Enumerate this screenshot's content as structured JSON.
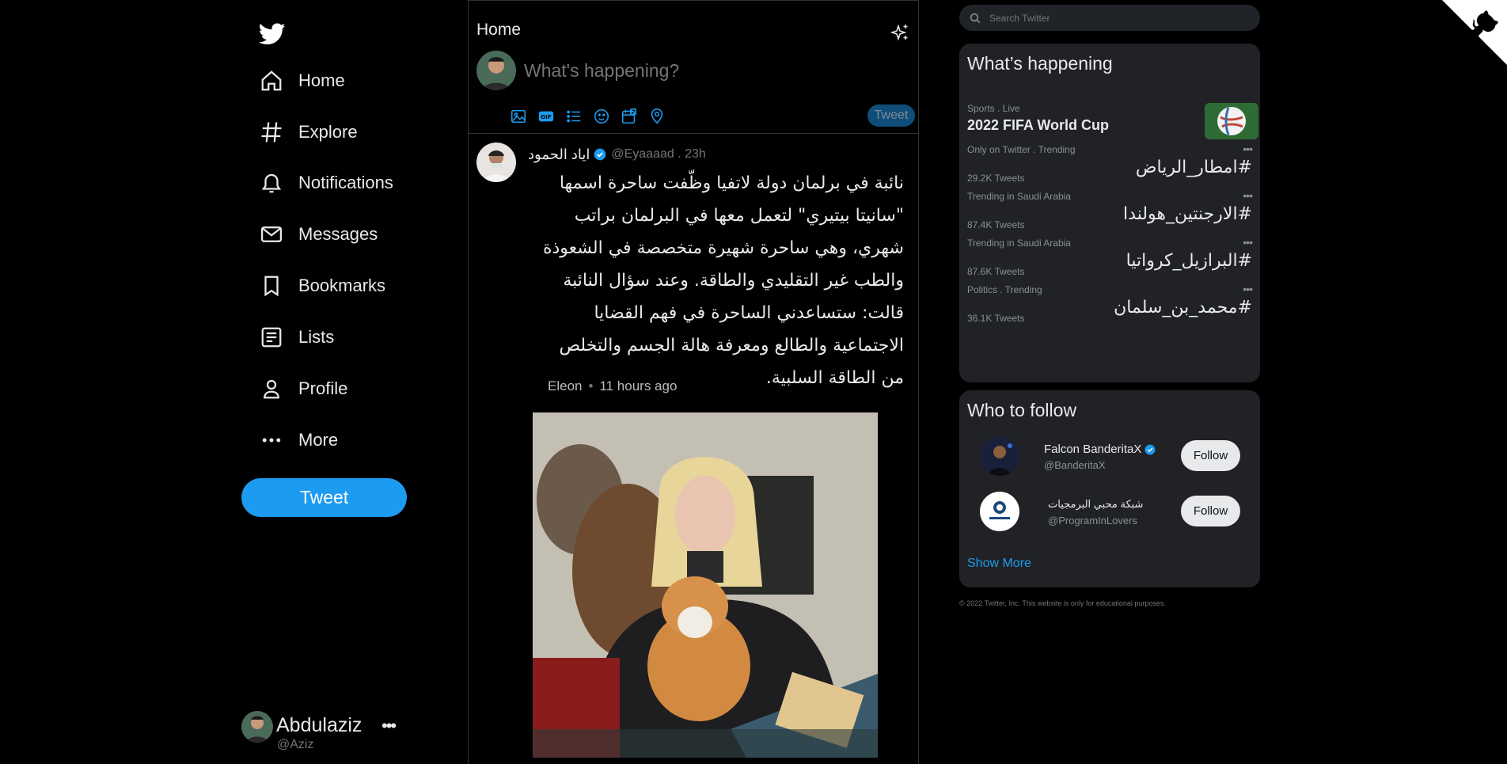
{
  "colors": {
    "accent": "#1d9bf0",
    "background": "#000000",
    "text": "#e7e9ea",
    "muted": "#71767b"
  },
  "sidebar": {
    "logo_icon": "twitter-bird-icon",
    "items": [
      {
        "label": "Home",
        "icon": "home-icon"
      },
      {
        "label": "Explore",
        "icon": "hashtag-icon"
      },
      {
        "label": "Notifications",
        "icon": "bell-icon"
      },
      {
        "label": "Messages",
        "icon": "envelope-icon"
      },
      {
        "label": "Bookmarks",
        "icon": "bookmark-icon"
      },
      {
        "label": "Lists",
        "icon": "list-icon"
      },
      {
        "label": "Profile",
        "icon": "person-icon"
      },
      {
        "label": "More",
        "icon": "more-dots-icon"
      }
    ],
    "tweet_label": "Tweet",
    "account": {
      "name": "Abdulaziz",
      "handle": "@Aziz",
      "more": "•••"
    }
  },
  "timeline": {
    "title": "Home",
    "compose": {
      "placeholder": "What's happening?",
      "tweet_label": "Tweet",
      "tools": [
        "image-icon",
        "gif-icon",
        "poll-icon",
        "emoji-icon",
        "schedule-icon",
        "location-icon"
      ]
    },
    "tweet": {
      "name": "اياد الحمود",
      "handle": "@Eyaaaad . 23h",
      "text": "نائبة في برلمان دولة لاتفيا وظّفت ساحرة اسمها \"سانيتا بيتيري\" لتعمل معها في البرلمان براتب شهري، وهي ساحرة شهيرة متخصصة في الشعوذة والطب غير التقليدي والطاقة. وعند سؤال النائبة قالت: ستساعدني الساحرة في فهم القضايا الاجتماعية والطالع ومعرفة هالة الجسم والتخلص من الطاقة السلبية.",
      "source": "Eleon",
      "time": "11 hours ago"
    }
  },
  "right": {
    "search_placeholder": "Search Twitter",
    "trends_title": "What’s happening",
    "featured": {
      "category": "Sports . Live",
      "title": "2022 FIFA World Cup"
    },
    "trends": [
      {
        "category": "Only on Twitter . Trending",
        "tag": "#امطار_الرياض",
        "count": "29.2K Tweets"
      },
      {
        "category": "Trending in Saudi Arabia",
        "tag": "#الارجنتين_هولندا",
        "count": "87.4K Tweets"
      },
      {
        "category": "Trending in Saudi Arabia",
        "tag": "#البرازيل_كرواتيا",
        "count": "87.6K Tweets"
      },
      {
        "category": "Politics . Trending",
        "tag": "#محمد_بن_سلمان",
        "count": "36.1K Tweets"
      }
    ],
    "trend_more": "•••",
    "follow_title": "Who to follow",
    "follow": [
      {
        "name": "Falcon BanderitaX",
        "handle": "@BanderitaX",
        "button": "Follow",
        "verified": true
      },
      {
        "name": "شبكة محبي البرمجيات",
        "handle": "@ProgramInLovers",
        "button": "Follow",
        "verified": false
      }
    ],
    "show_more": "Show More",
    "footer": "© 2022 Twitter, Inc. This website is only for educational purposes."
  }
}
